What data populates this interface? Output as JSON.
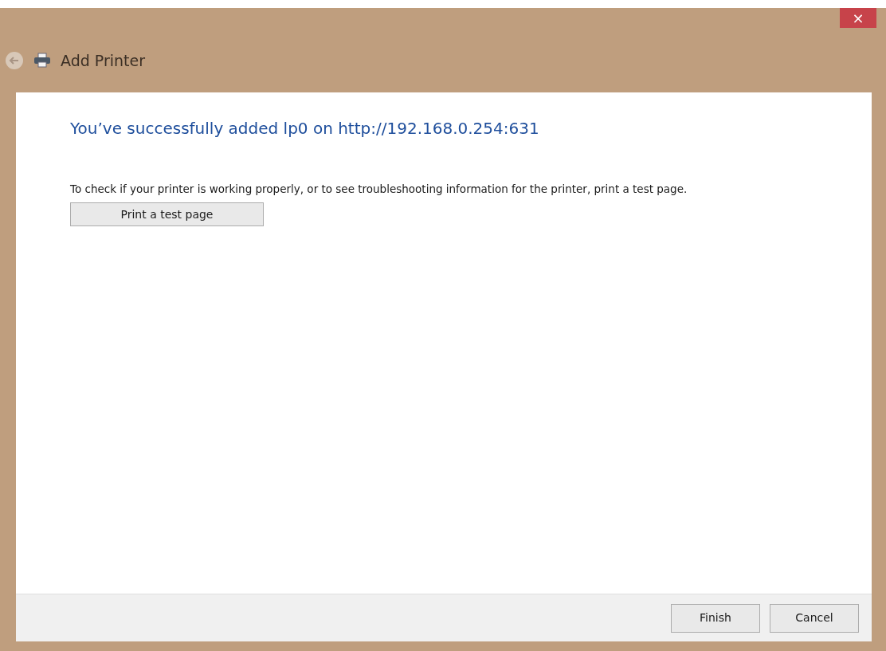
{
  "window": {
    "close_glyph": "×",
    "title": "Add Printer"
  },
  "content": {
    "heading": "You’ve successfully added lp0 on http://192.168.0.254:631",
    "description": "To check if your printer is working properly, or to see troubleshooting information for the printer, print a test page.",
    "test_button": "Print a test page"
  },
  "buttons": [
    "Finish",
    "Cancel"
  ]
}
